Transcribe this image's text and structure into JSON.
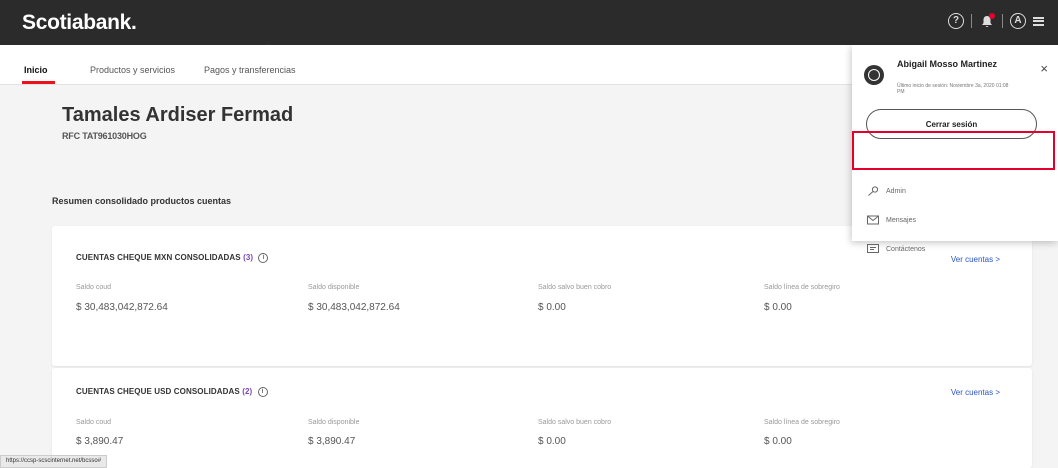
{
  "header": {
    "logo": "Scotiabank.",
    "help_icon": "?",
    "bell_icon": "bell-icon",
    "user_initial": "A"
  },
  "nav": {
    "tabs": [
      {
        "label": "Inicio",
        "active": true
      },
      {
        "label": "Productos y servicios",
        "active": false
      },
      {
        "label": "Pagos y transferencias",
        "active": false
      }
    ]
  },
  "company": {
    "name": "Tamales Ardiser Fermad",
    "rfc": "RFC TAT961030HOG"
  },
  "summary_title": "Resumen consolidado productos cuentas",
  "cards": [
    {
      "title": "CUENTAS CHEQUE MXN CONSOLIDADAS",
      "count": "(3)",
      "link": "Ver cuentas >",
      "columns": [
        {
          "label": "Saldo coud",
          "value": "$ 30,483,042,872.64"
        },
        {
          "label": "Saldo disponible",
          "value": "$ 30,483,042,872.64"
        },
        {
          "label": "Saldo salvo buen cobro",
          "value": "$ 0.00"
        },
        {
          "label": "Saldo línea de sobregiro",
          "value": "$ 0.00"
        }
      ]
    },
    {
      "title": "CUENTAS CHEQUE USD CONSOLIDADAS",
      "count": "(2)",
      "link": "Ver cuentas >",
      "columns": [
        {
          "label": "Saldo coud",
          "value": "$ 3,890.47"
        },
        {
          "label": "Saldo disponible",
          "value": "$ 3,890.47"
        },
        {
          "label": "Saldo salvo buen cobro",
          "value": "$ 0.00"
        },
        {
          "label": "Saldo línea de sobregiro",
          "value": "$ 0.00"
        }
      ]
    }
  ],
  "user_panel": {
    "name": "Abigail Mosso Martinez",
    "last_session": "Último inicio de sesión: Noviembre 3a, 2020 01:08 PM",
    "close": "×",
    "logout": "Cerrar sesión",
    "items": [
      {
        "label": "Admin",
        "icon": "key-icon"
      },
      {
        "label": "Mensajes",
        "icon": "envelope-icon"
      },
      {
        "label": "Contáctenos",
        "icon": "chat-icon"
      }
    ]
  },
  "status_url": "https://ccsp-scscinternet.net/bcsso#",
  "colors": {
    "brand_red": "#ec111a",
    "topbar": "#2b2b2b",
    "link_blue": "#2a55c8",
    "count_purple": "#7849b8"
  }
}
